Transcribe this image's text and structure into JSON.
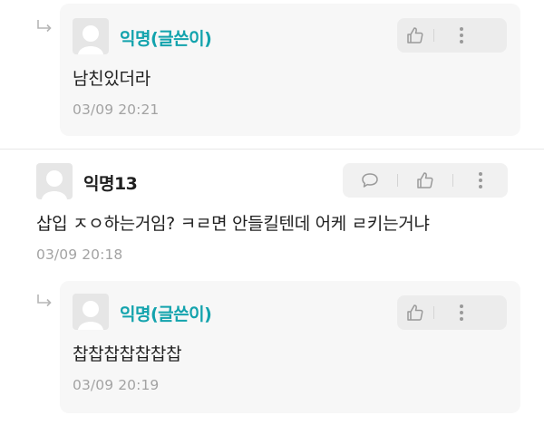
{
  "comments": [
    {
      "type": "reply",
      "author": "익명(글쓴이)",
      "text": "남친있더라",
      "time": "03/09 20:21"
    },
    {
      "type": "comment",
      "author": "익명13",
      "text": "삽입 ㅈㅇ하는거임? ㅋㄹ면 안들킬텐데 어케 ㄹ키는거냐",
      "time": "03/09 20:18"
    },
    {
      "type": "reply",
      "author": "익명(글쓴이)",
      "text": "찹찹찹찹찹찹찹",
      "time": "03/09 20:19"
    }
  ],
  "icons": {
    "reply_indicator": "reply-arrow-icon",
    "like": "thumbs-up-icon",
    "comment": "speech-bubble-icon",
    "more": "more-vertical-icon",
    "avatar": "default-avatar-icon"
  },
  "colors": {
    "author_op": "#13a3ad",
    "author": "#1f1f1f",
    "timestamp": "#a3a3a3",
    "reply_background": "#f7f7f7",
    "action_background": "#ececec"
  }
}
